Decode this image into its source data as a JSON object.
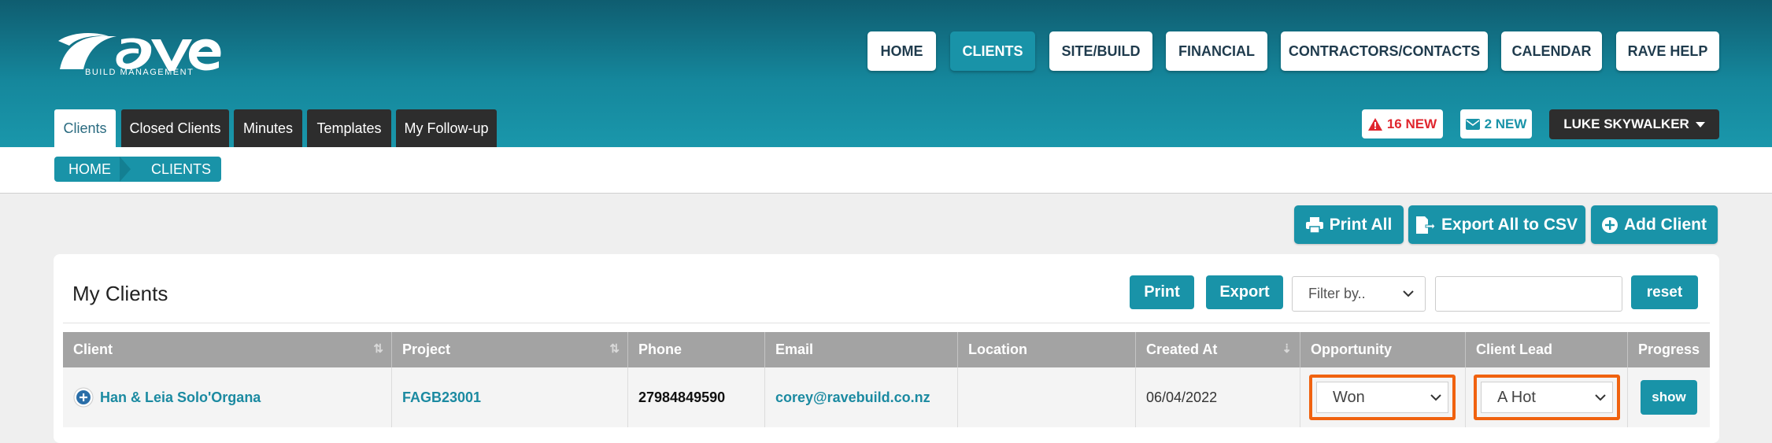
{
  "header": {
    "logo_text": "rave",
    "logo_sub": "BUILD MANAGEMENT",
    "nav": [
      "HOME",
      "CLIENTS",
      "SITE/BUILD",
      "FINANCIAL",
      "CONTRACTORS/CONTACTS",
      "CALENDAR",
      "RAVE HELP"
    ],
    "active_nav": "CLIENTS",
    "tabs": [
      "Clients",
      "Closed Clients",
      "Minutes",
      "Templates",
      "My Follow-up"
    ],
    "alerts_label": "16 NEW",
    "messages_label": "2 NEW",
    "user_name": "LUKE SKYWALKER"
  },
  "breadcrumb": [
    "HOME",
    "CLIENTS"
  ],
  "actions": {
    "print_all": "Print All",
    "export_all": "Export All to CSV",
    "add_client": "Add Client"
  },
  "panel": {
    "title": "My Clients",
    "print": "Print",
    "export": "Export",
    "filter_placeholder": "Filter by..",
    "search_value": "",
    "reset": "reset"
  },
  "table": {
    "columns": [
      "Client",
      "Project",
      "Phone",
      "Email",
      "Location",
      "Created At",
      "Opportunity",
      "Client Lead",
      "Progress"
    ],
    "rows": [
      {
        "client": "Han & Leia Solo'Organa",
        "project": "FAGB23001",
        "phone": "27984849590",
        "email": "corey@ravebuild.co.nz",
        "location": "",
        "created_at": "06/04/2022",
        "opportunity": "Won",
        "client_lead": "A Hot",
        "progress": "show"
      }
    ]
  },
  "colors": {
    "teal": "#1993a8",
    "header_dark": "#0f5d70",
    "dark": "#2d2d2d",
    "highlight": "#f0620f",
    "alert_red": "#e0262e"
  }
}
